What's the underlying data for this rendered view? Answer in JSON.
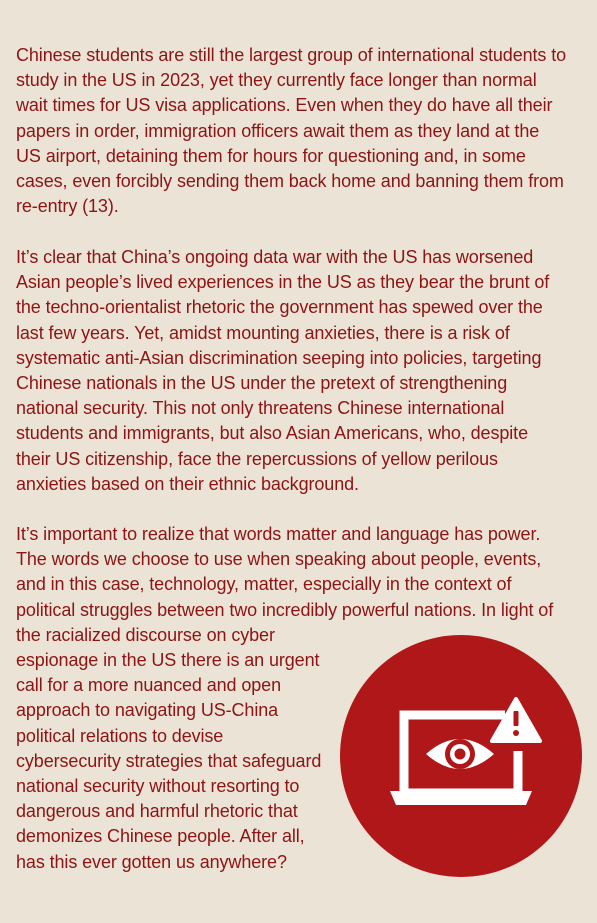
{
  "article": {
    "paragraphs": [
      {
        "lines": [
          "Chinese students are still the largest group of international students to",
          "study in the US in 2023, yet they currently face longer than normal",
          "wait times for US visa applications. Even when they do have all their",
          "papers in order, immigration officers await them as they land at the",
          "US airport, detaining them for hours for questioning and, in some",
          "cases, even forcibly sending them back home and banning them from",
          "re-entry (13)."
        ]
      },
      {
        "lines": [
          "It’s clear that China’s ongoing data war with the US has worsened",
          "Asian people’s lived experiences in the US as they bear the brunt of",
          "the techno-orientalist rhetoric the government has spewed over the",
          "last few years. Yet, amidst mounting anxieties, there is a risk of",
          "systematic anti-Asian discrimination seeping into policies, targeting",
          "Chinese nationals in the US under the pretext of strengthening",
          "national security. This not only threatens Chinese international",
          "students and immigrants, but also Asian Americans, who, despite",
          "their US citizenship, face the repercussions of yellow perilous",
          "anxieties based on their ethnic background."
        ]
      },
      {
        "lines": [
          "It’s important to realize that words matter and language has power.",
          "The words we choose to use when speaking about people, events,",
          "and in this case, technology, matter, especially in the context of",
          "political struggles between two incredibly powerful nations. In light of",
          "the racialized discourse on cyber",
          "espionage in the US there is an urgent",
          "call for a more nuanced and open",
          "approach to navigating US-China",
          "political relations to devise",
          "cybersecurity strategies that safeguard",
          "national security without resorting to",
          "dangerous and harmful rhetoric that",
          "demonizes Chinese people. After all,",
          "has this ever gotten us anywhere?"
        ]
      }
    ]
  },
  "illustration": {
    "icon": "laptop-surveillance-eye-warning-icon",
    "colors": {
      "circle": "#b01718",
      "icon": "#ffffff",
      "text": "#8c1414",
      "background": "#ebe3d6"
    }
  }
}
